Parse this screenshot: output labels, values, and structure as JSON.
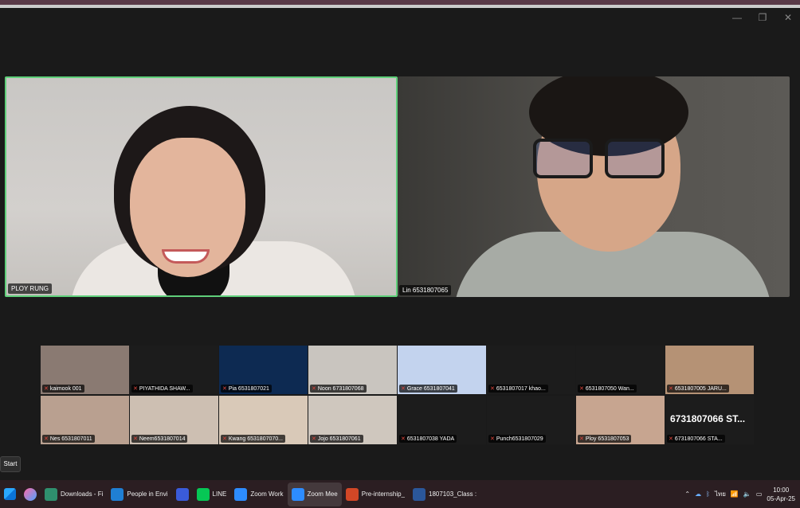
{
  "main": {
    "tile_a_name": "PLOY RUNG",
    "tile_b_name": "Lin 6531807065"
  },
  "gallery": [
    {
      "name": "kaimook 001",
      "bg": "#8a7a72"
    },
    {
      "name": "PIYATHIDA SHAW...",
      "bg": "#1c1c1c"
    },
    {
      "name": "Pia 6531807021",
      "bg": "#0d2a52"
    },
    {
      "name": "Noon 6731807068",
      "bg": "#c9c5bf"
    },
    {
      "name": "Grace 6531807041",
      "bg": "#c3d3ee"
    },
    {
      "name": "6531807017 khao...",
      "bg": "#1c1c1c"
    },
    {
      "name": "6531807050 Wan...",
      "bg": "#1c1c1c"
    },
    {
      "name": "6531807005 JARU...",
      "bg": "#b59275"
    },
    {
      "name": "Nes 6531807011",
      "bg": "#b9a090"
    },
    {
      "name": "Neem6531807014",
      "bg": "#cdbfb2"
    },
    {
      "name": "Kwang 6531807070...",
      "bg": "#d9c9b8"
    },
    {
      "name": "Jojo 6531807061",
      "bg": "#cfc7be"
    },
    {
      "name": "6531807038 YADA",
      "bg": "#1c1c1c"
    },
    {
      "name": "Punch6531807029",
      "bg": "#1c1c1c"
    },
    {
      "name": "Ploy 6531807053",
      "bg": "#c7a590"
    },
    {
      "name": "6731807066 STA...",
      "bg": "#1c1c1c",
      "big_label": "6731807066  ST..."
    }
  ],
  "start_label": "Start",
  "window_controls": {
    "minimize": "—",
    "restore": "❐",
    "close": "✕"
  },
  "taskbar": {
    "items": [
      {
        "label": "Downloads - Fi",
        "icon_color": "#2f8f6e"
      },
      {
        "label": "People in Envi",
        "icon_color": "#1f7fd4"
      },
      {
        "label": "",
        "icon_color": "#3a5bd9"
      },
      {
        "label": "LINE",
        "icon_color": "#06c755"
      },
      {
        "label": "Zoom Work",
        "icon_color": "#2d8cff"
      },
      {
        "label": "Zoom Mee",
        "icon_color": "#2d8cff"
      },
      {
        "label": "Pre-internship_",
        "icon_color": "#d24726"
      },
      {
        "label": "1807103_Class :",
        "icon_color": "#2b579a"
      }
    ],
    "tray": {
      "lang": "ไทย",
      "time": "10:00",
      "date": "05-Apr-25"
    }
  }
}
